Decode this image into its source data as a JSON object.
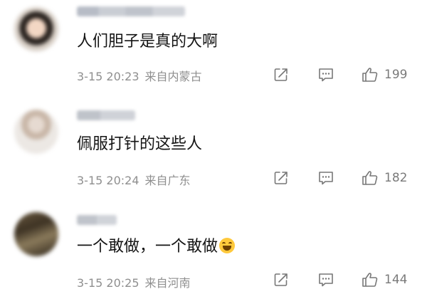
{
  "comments": [
    {
      "content": "人们胆子是真的大啊",
      "time": "3-15 20:23",
      "location": "来自内蒙古",
      "likes": "199"
    },
    {
      "content": "佩服打针的这些人",
      "time": "3-15 20:24",
      "location": "来自广东",
      "likes": "182"
    },
    {
      "content": "一个敢做，一个敢做",
      "time": "3-15 20:25",
      "location": "来自河南",
      "likes": "144"
    }
  ],
  "icons": {
    "share": "share-icon",
    "reply": "comment-icon",
    "like": "thumbs-up-icon",
    "emoji": "laughing-face-icon"
  },
  "colors": {
    "text_primary": "#141414",
    "text_secondary": "#8f8f8f",
    "icon": "#777777"
  }
}
